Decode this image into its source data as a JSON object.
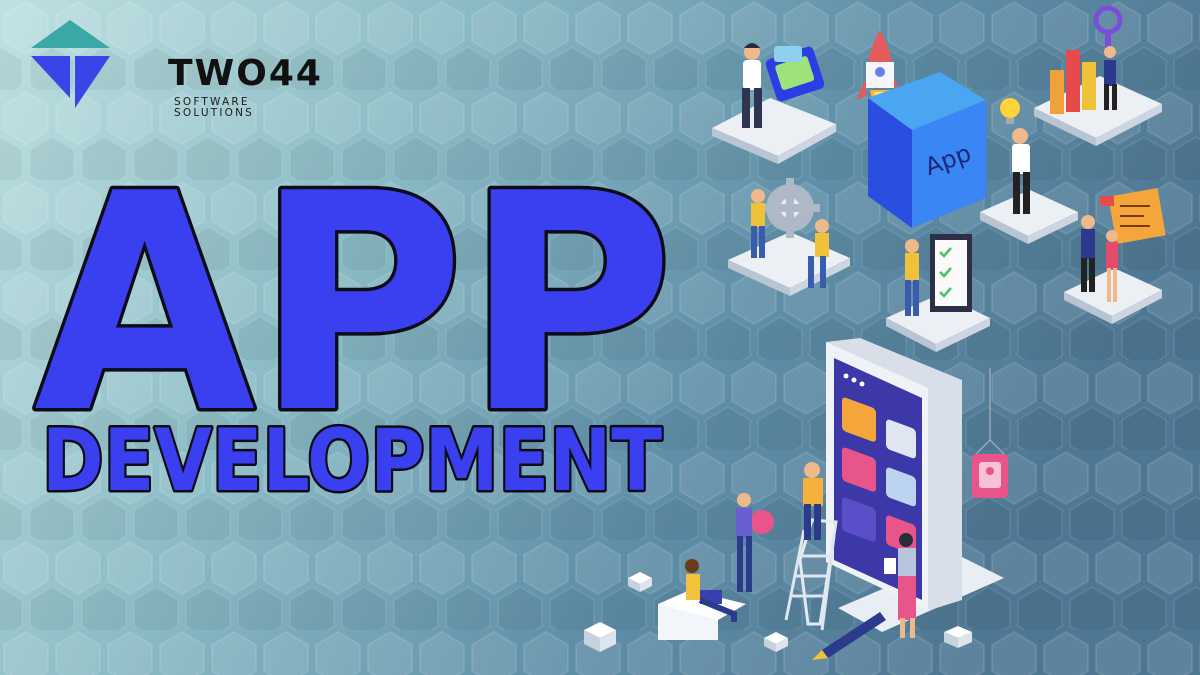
{
  "brand": {
    "name": "TWO44",
    "tagline": "SOFTWARE SOLUTIONS",
    "colors": {
      "logo_teal": "#3aa8a6",
      "logo_blue": "#3a45e8"
    }
  },
  "headline": {
    "line1": "APP",
    "line2": "DEVELOPMENT",
    "fill_color": "#3a3ff0",
    "stroke_color": "#0d0d1a"
  },
  "illustration": {
    "app_cube_label": "App",
    "phone_icons": [
      "phone-icon",
      "image-icon",
      "code-icon",
      "braces-icon",
      "gear-icon",
      "dots-icon"
    ]
  },
  "background": {
    "colors": [
      "#b9dcdf",
      "#6da1b4",
      "#4d7896"
    ],
    "pattern": "hexagon-icon"
  }
}
